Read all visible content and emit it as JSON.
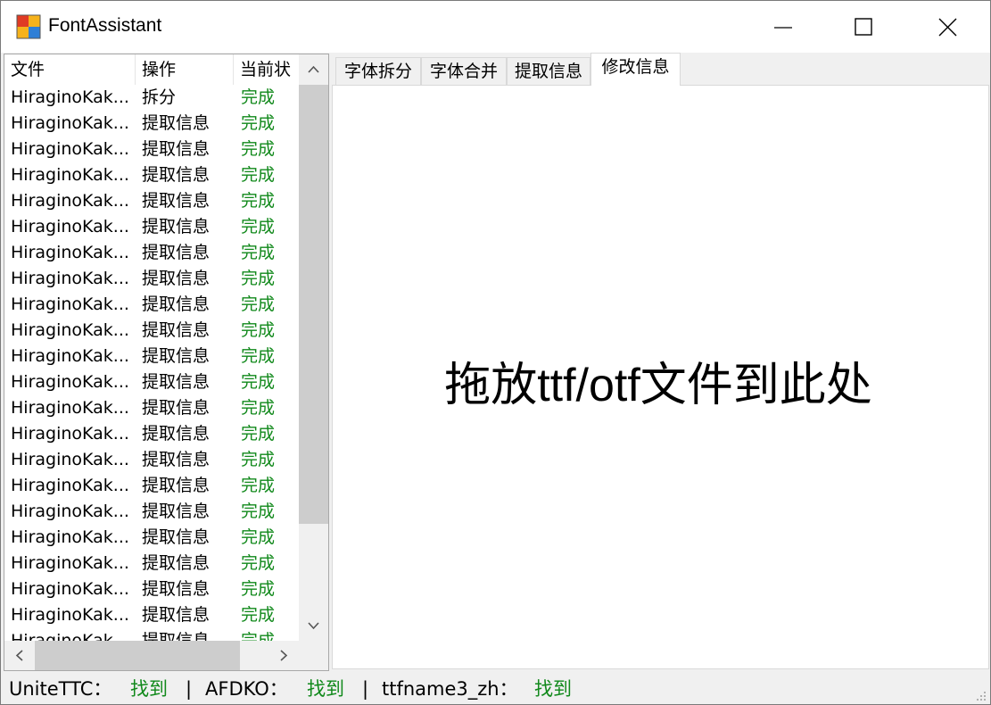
{
  "window": {
    "title": "FontAssistant"
  },
  "list": {
    "columns": {
      "file": "文件",
      "operation": "操作",
      "state": "当前状"
    },
    "rows": [
      {
        "file": "HiraginoKak...",
        "op": "拆分",
        "state": "完成"
      },
      {
        "file": "HiraginoKak...",
        "op": "提取信息",
        "state": "完成"
      },
      {
        "file": "HiraginoKak...",
        "op": "提取信息",
        "state": "完成"
      },
      {
        "file": "HiraginoKak...",
        "op": "提取信息",
        "state": "完成"
      },
      {
        "file": "HiraginoKak...",
        "op": "提取信息",
        "state": "完成"
      },
      {
        "file": "HiraginoKak...",
        "op": "提取信息",
        "state": "完成"
      },
      {
        "file": "HiraginoKak...",
        "op": "提取信息",
        "state": "完成"
      },
      {
        "file": "HiraginoKak...",
        "op": "提取信息",
        "state": "完成"
      },
      {
        "file": "HiraginoKak...",
        "op": "提取信息",
        "state": "完成"
      },
      {
        "file": "HiraginoKak...",
        "op": "提取信息",
        "state": "完成"
      },
      {
        "file": "HiraginoKak...",
        "op": "提取信息",
        "state": "完成"
      },
      {
        "file": "HiraginoKak...",
        "op": "提取信息",
        "state": "完成"
      },
      {
        "file": "HiraginoKak...",
        "op": "提取信息",
        "state": "完成"
      },
      {
        "file": "HiraginoKak...",
        "op": "提取信息",
        "state": "完成"
      },
      {
        "file": "HiraginoKak...",
        "op": "提取信息",
        "state": "完成"
      },
      {
        "file": "HiraginoKak...",
        "op": "提取信息",
        "state": "完成"
      },
      {
        "file": "HiraginoKak...",
        "op": "提取信息",
        "state": "完成"
      },
      {
        "file": "HiraginoKak...",
        "op": "提取信息",
        "state": "完成"
      },
      {
        "file": "HiraginoKak...",
        "op": "提取信息",
        "state": "完成"
      },
      {
        "file": "HiraginoKak...",
        "op": "提取信息",
        "state": "完成"
      },
      {
        "file": "HiraginoKak...",
        "op": "提取信息",
        "state": "完成"
      },
      {
        "file": "HiraginoKak...",
        "op": "提取信息",
        "state": "完成"
      }
    ]
  },
  "tabs": [
    {
      "label": "字体拆分"
    },
    {
      "label": "字体合并"
    },
    {
      "label": "提取信息"
    },
    {
      "label": "修改信息",
      "active": true
    }
  ],
  "drop_zone": {
    "text": "拖放ttf/otf文件到此处"
  },
  "status": {
    "unitettc_label": "UniteTTC：",
    "unitettc_value": "找到",
    "sep1": "|",
    "afdko_label": "AFDKO：",
    "afdko_value": "找到",
    "sep2": "|",
    "ttfname_label": "ttfname3_zh：",
    "ttfname_value": "找到"
  },
  "colors": {
    "ok": "#11891b"
  }
}
